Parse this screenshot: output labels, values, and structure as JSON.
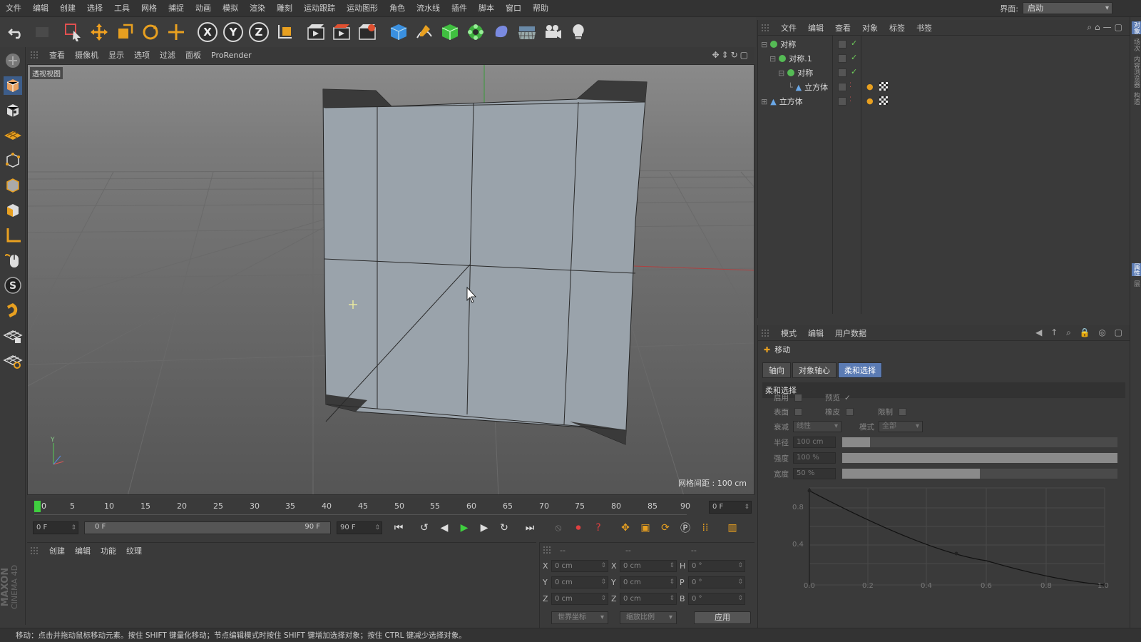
{
  "menu": [
    "文件",
    "编辑",
    "创建",
    "选择",
    "工具",
    "网格",
    "捕捉",
    "动画",
    "模拟",
    "渲染",
    "雕刻",
    "运动跟踪",
    "运动图形",
    "角色",
    "流水线",
    "插件",
    "脚本",
    "窗口",
    "帮助"
  ],
  "interface": {
    "label": "界面:",
    "value": "启动"
  },
  "viewport": {
    "menu": [
      "查看",
      "摄像机",
      "显示",
      "选项",
      "过滤",
      "面板",
      "ProRender"
    ],
    "label": "透视视图",
    "grid_note": "网格间距 : 100 cm"
  },
  "timeline": {
    "ticks": [
      "0",
      "5",
      "10",
      "15",
      "20",
      "25",
      "30",
      "35",
      "40",
      "45",
      "50",
      "55",
      "60",
      "65",
      "70",
      "75",
      "80",
      "85",
      "90"
    ],
    "current_frame_display": "0 F",
    "start": "0 F",
    "range_start": "0 F",
    "range_end": "90 F",
    "end": "90 F"
  },
  "material_manager": {
    "menu": [
      "创建",
      "编辑",
      "功能",
      "纹理"
    ]
  },
  "coordinates": {
    "head": [
      "--",
      "--",
      "--"
    ],
    "rows": [
      {
        "a": "X",
        "av": "0 cm",
        "b": "X",
        "bv": "0 cm",
        "c": "H",
        "cv": "0 °"
      },
      {
        "a": "Y",
        "av": "0 cm",
        "b": "Y",
        "bv": "0 cm",
        "c": "P",
        "cv": "0 °"
      },
      {
        "a": "Z",
        "av": "0 cm",
        "b": "Z",
        "bv": "0 cm",
        "c": "B",
        "cv": "0 °"
      }
    ],
    "world": "世界坐标",
    "scale": "缩放比例",
    "apply": "应用"
  },
  "object_manager": {
    "menu": [
      "文件",
      "编辑",
      "查看",
      "对象",
      "标签",
      "书签"
    ],
    "objects": [
      {
        "name": "对称",
        "indent": 0
      },
      {
        "name": "对称.1",
        "indent": 1
      },
      {
        "name": "对称",
        "indent": 2
      },
      {
        "name": "立方体",
        "indent": 3
      },
      {
        "name": "立方体",
        "indent": 0
      }
    ]
  },
  "attributes": {
    "menu": [
      "模式",
      "编辑",
      "用户数据"
    ],
    "tool": "移动",
    "tabs": [
      "轴向",
      "对象轴心",
      "柔和选择"
    ],
    "section": "柔和选择",
    "enable": "启用",
    "preview": "预览",
    "surface": "表面",
    "rubber": "橡皮",
    "limit": "限制",
    "falloff": "衰减",
    "falloff_value": "线性",
    "mode": "模式",
    "mode_value": "全部",
    "radius": "半径",
    "radius_value": "100 cm",
    "strength": "强度",
    "strength_value": "100 %",
    "width": "宽度",
    "width_value": "50 %",
    "graph_y": [
      "0.8",
      "0.4"
    ],
    "graph_x": [
      "0.0",
      "0.2",
      "0.4",
      "0.6",
      "0.8",
      "1.0"
    ]
  },
  "brand": {
    "line1": "MAXON",
    "line2": "CINEMA 4D"
  },
  "status": "移动：点击并拖动鼠标移动元素。按住 SHIFT 键量化移动；节点编辑模式时按住 SHIFT 键增加选择对象；按住 CTRL 键减少选择对象。",
  "colors": {
    "accent": "#5b7bb3",
    "check": "#6fcf5a",
    "play": "#3fcf3f"
  }
}
